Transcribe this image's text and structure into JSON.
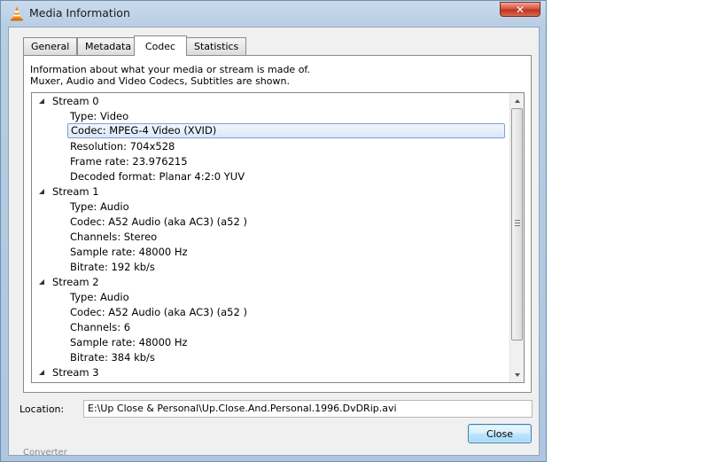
{
  "window": {
    "title": "Media Information",
    "close_glyph": "✕",
    "app_icon": "vlc-cone-icon"
  },
  "tabs": [
    {
      "label": "General",
      "active": false
    },
    {
      "label": "Metadata",
      "active": false
    },
    {
      "label": "Codec",
      "active": true
    },
    {
      "label": "Statistics",
      "active": false
    }
  ],
  "codec_panel": {
    "info_line1": "Information about what your media or stream is made of.",
    "info_line2": "Muxer, Audio and Video Codecs, Subtitles are shown.",
    "selected_row": "Codec: MPEG-4 Video (XVID)",
    "streams": [
      {
        "label": "Stream 0",
        "props": [
          "Type: Video",
          "Codec: MPEG-4 Video (XVID)",
          "Resolution: 704x528",
          "Frame rate: 23.976215",
          "Decoded format: Planar 4:2:0 YUV"
        ]
      },
      {
        "label": "Stream 1",
        "props": [
          "Type: Audio",
          "Codec: A52 Audio (aka AC3) (a52 )",
          "Channels: Stereo",
          "Sample rate: 48000 Hz",
          "Bitrate: 192 kb/s"
        ]
      },
      {
        "label": "Stream 2",
        "props": [
          "Type: Audio",
          "Codec: A52 Audio (aka AC3) (a52 )",
          "Channels: 6",
          "Sample rate: 48000 Hz",
          "Bitrate: 384 kb/s"
        ]
      },
      {
        "label": "Stream 3",
        "props": []
      }
    ]
  },
  "location": {
    "label": "Location:",
    "value": "E:\\Up Close & Personal\\Up.Close.And.Personal.1996.DvDRip.avi"
  },
  "buttons": {
    "close_label": "Close"
  },
  "background_text": "Converter",
  "colors": {
    "selection_border": "#7da2ce",
    "titlebar_close": "#c0321f"
  }
}
